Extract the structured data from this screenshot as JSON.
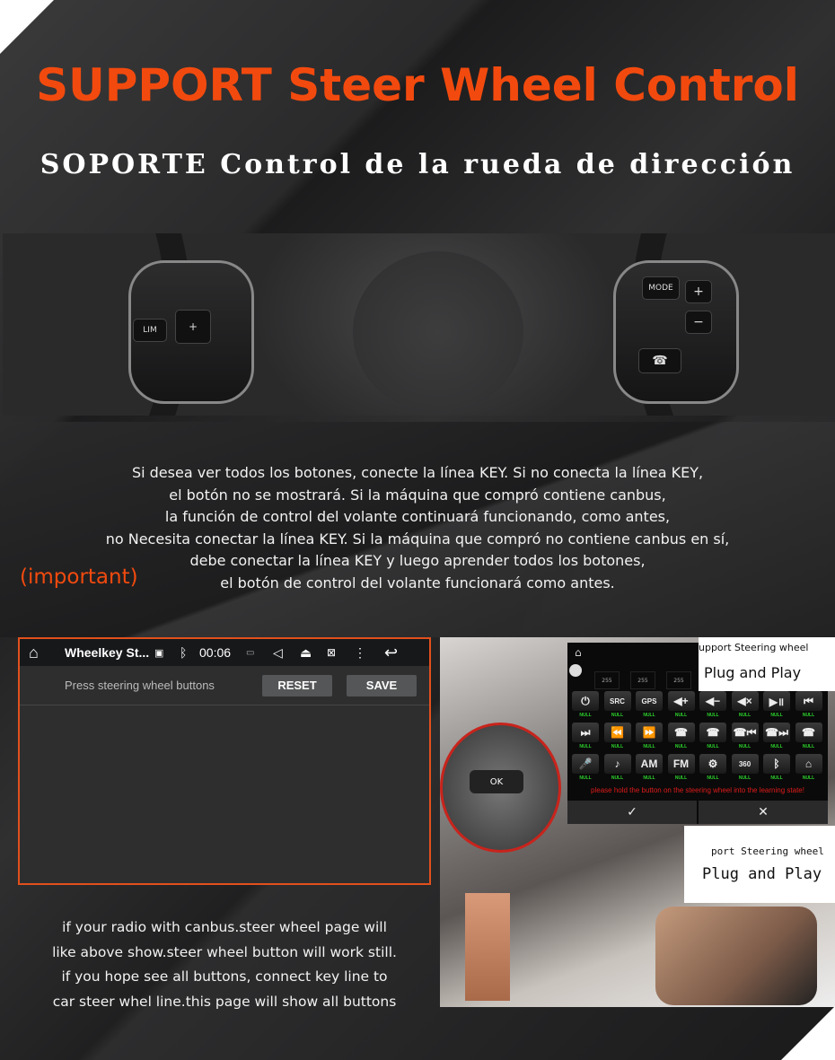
{
  "title": "SUPPORT Steer Wheel Control",
  "subtitle": "SOPORTE Control de la rueda de dirección",
  "wheel_buttons": {
    "mode": "MODE",
    "plus": "+",
    "minus": "−",
    "lim": "LIM"
  },
  "paragraph_lines": [
    "Si desea ver todos los botones, conecte la línea KEY. Si no conecta la línea KEY,",
    "el botón no se mostrará. Si la máquina que compró contiene canbus,",
    "la función de control del volante continuará funcionando, como antes,",
    "no Necesita conectar la línea KEY. Si la máquina que compró no contiene canbus en sí,",
    "debe conectar la línea KEY y luego aprender todos los botones,",
    "el botón de control del volante funcionará como antes."
  ],
  "important": "(important)",
  "app": {
    "status_bar": {
      "title": "Wheelkey St...",
      "time": "00:06",
      "icons": [
        "home-icon",
        "image-icon",
        "bluetooth-icon",
        "radio-icon",
        "volume-icon",
        "eject-icon",
        "screen-off-icon",
        "more-icon",
        "back-icon"
      ]
    },
    "prompt": "Press steering wheel buttons",
    "reset": "RESET",
    "save": "SAVE"
  },
  "caption_lines": [
    "if your radio with canbus.steer wheel page will",
    "like above show.steer wheel button will work still.",
    "if you hope see all buttons, connect key line to",
    "car steer whel line.this page will show all buttons"
  ],
  "learning": {
    "values": [
      "255",
      "255",
      "255"
    ],
    "buttons": [
      "⏻",
      "SRC",
      "GPS",
      "◀+",
      "◀−",
      "◀×",
      "▶॥",
      "⏮",
      "⏭",
      "⏪",
      "⏩",
      "☎",
      "☎",
      "☎⏮",
      "☎⏭",
      "☎",
      "🎤",
      "♪",
      "AM",
      "FM",
      "⚙",
      "360",
      "ᛒ",
      "⌂"
    ],
    "button_label": "NULL",
    "instruction": "please hold the button on the steering wheel into the learning state!",
    "ok": "✓",
    "cancel": "✕",
    "colors": {
      "null": "#2cd52c",
      "instruction": "#e01a1a"
    }
  },
  "overlay1": {
    "line1": "upport Steering wheel",
    "line2": "Plug and Play"
  },
  "overlay2": {
    "line1": "port Steering wheel",
    "line2": "Plug and Play"
  },
  "colors": {
    "accent": "#f24a0e",
    "background": "#1e1e1f"
  }
}
